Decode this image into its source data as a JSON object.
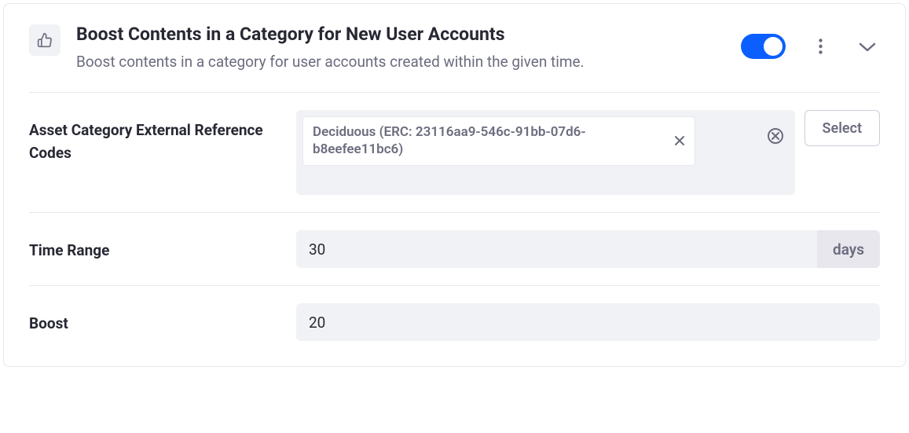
{
  "header": {
    "title": "Boost Contents in a Category for New User Accounts",
    "description": "Boost contents in a category for user accounts created within the given time.",
    "toggle_on": true
  },
  "fields": {
    "categories": {
      "label": "Asset Category External Reference Codes",
      "select_button": "Select",
      "tags": [
        {
          "label": "Deciduous (ERC: 23116aa9-546c-91bb-07d6-b8eefee11bc6)"
        }
      ]
    },
    "time_range": {
      "label": "Time Range",
      "value": "30",
      "suffix": "days"
    },
    "boost": {
      "label": "Boost",
      "value": "20"
    }
  }
}
